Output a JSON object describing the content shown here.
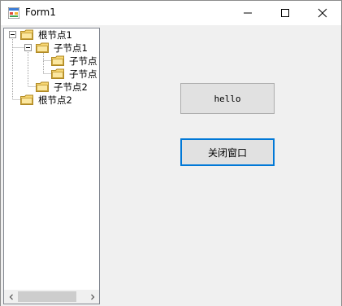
{
  "window": {
    "title": "Form1"
  },
  "tree": {
    "nodes": [
      {
        "label": "根节点1",
        "expanded": true,
        "level": 0
      },
      {
        "label": "子节点1",
        "expanded": true,
        "level": 1
      },
      {
        "label": "子节点",
        "level": 2
      },
      {
        "label": "子节点",
        "level": 2
      },
      {
        "label": "子节点2",
        "level": 1
      },
      {
        "label": "根节点2",
        "level": 0
      }
    ]
  },
  "buttons": {
    "hello_label": "hello",
    "close_label": "关闭窗口"
  },
  "colors": {
    "focus_border": "#0078d7",
    "folder": "#f7d774"
  },
  "icons": {
    "app": "form-icon",
    "minimize": "minimize-icon",
    "maximize": "maximize-icon",
    "close": "close-icon",
    "folder": "folder-icon",
    "expander": "minus-box-icon"
  }
}
